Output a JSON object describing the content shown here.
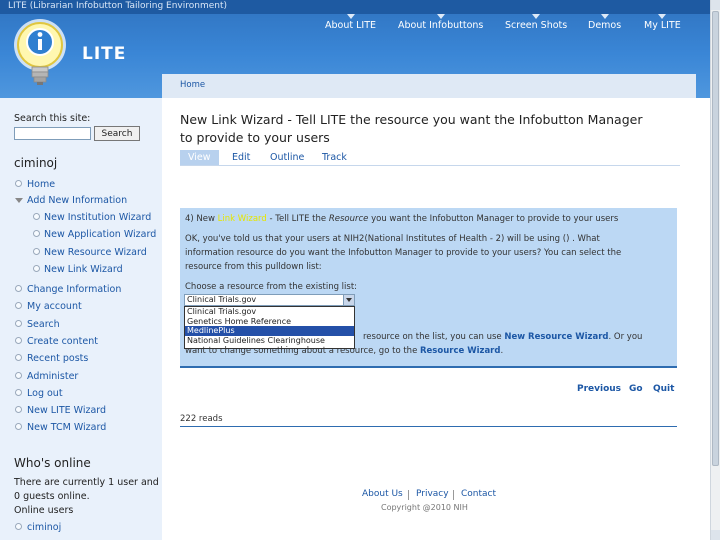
{
  "window": {
    "title": "LITE (Librarian Infobutton Tailoring Environment)"
  },
  "header": {
    "logo_text": "LITE",
    "nav": [
      "About LITE",
      "About Infobuttons",
      "Screen Shots",
      "Demos",
      "My LITE"
    ]
  },
  "breadcrumb": "Home",
  "sidebar": {
    "search_label": "Search this site:",
    "search_value": "",
    "search_button": "Search",
    "username": "ciminoj",
    "items": [
      {
        "label": "Home"
      },
      {
        "label": "Add New Information"
      },
      {
        "label": "New Institution Wizard"
      },
      {
        "label": "New Application Wizard"
      },
      {
        "label": "New Resource Wizard"
      },
      {
        "label": "New Link Wizard"
      },
      {
        "label": "Change Information"
      },
      {
        "label": "My account"
      },
      {
        "label": "Search"
      },
      {
        "label": "Create content"
      },
      {
        "label": "Recent posts"
      },
      {
        "label": "Administer"
      },
      {
        "label": "Log out"
      },
      {
        "label": "New LITE Wizard"
      },
      {
        "label": "New TCM Wizard"
      }
    ],
    "whos_online_title": "Who's online",
    "online_text_1": "There are currently 1 user and",
    "online_text_2": "0 guests online.",
    "online_users_label": "Online users",
    "online_user": "ciminoj"
  },
  "main": {
    "title": "New Link Wizard - Tell LITE the resource you want the Infobutton Manager to provide to your users",
    "tabs": [
      "View",
      "Edit",
      "Outline",
      "Track"
    ],
    "step_prefix": "4) New ",
    "step_link": "Link Wizard",
    "step_mid": " - Tell LITE the ",
    "step_em": "Resource",
    "step_suffix": " you want the Infobutton Manager to provide to your users",
    "para1": "OK, you've told us that your users at NIH2(National Institutes of Health - 2) will be using () . What",
    "para2": "information resource do you want the Infobutton Manager to provide to your users? You can select the",
    "para3": "resource from this pulldown list:",
    "choose_label": "Choose a resource from the existing list:",
    "select_value": "Clinical Trials.gov",
    "options": [
      "Clinical Trials.gov",
      "Genetics Home Reference",
      "MedlinePlus",
      "National Guidelines Clearinghouse"
    ],
    "selected_option": "MedlinePlus",
    "after1_prefix": "resource on the list, you can use ",
    "after1_link": "New Resource Wizard",
    "after1_suffix": ". Or you",
    "after2_prefix": "want to change something about a resource, go to the ",
    "after2_link": "Resource Wizard",
    "after2_suffix": ".",
    "pager": [
      "Previous",
      "Go",
      "Quit"
    ],
    "reads": "222 reads"
  },
  "footer": {
    "links": [
      "About Us",
      "Privacy",
      "Contact"
    ],
    "copyright": "Copyright @2010 NIH"
  },
  "colors": {
    "header": "#3a86d6",
    "sidebar": "#e9f1fb",
    "content_box": "#bcd8f4",
    "link": "#1c57a5",
    "selected": "#2450a8"
  }
}
